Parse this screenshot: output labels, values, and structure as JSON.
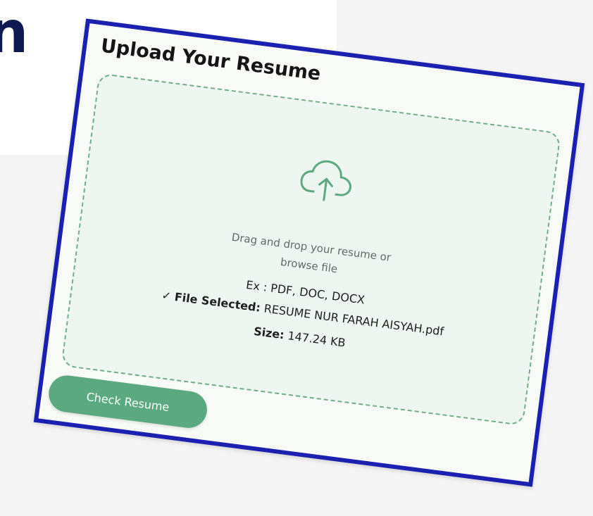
{
  "background": {
    "heading_fragment": "n"
  },
  "upload_card": {
    "title": "Upload Your Resume",
    "dropzone": {
      "icon": "cloud-upload-icon",
      "instruction_line1": "Drag and drop your resume or",
      "instruction_line2": "browse file",
      "formats": "Ex : PDF, DOC, DOCX",
      "file_selected_check": "✓",
      "file_selected_label": "File Selected:",
      "file_name": "RESUME NUR FARAH AISYAH.pdf",
      "size_label": "Size:",
      "size_value": "147.24 KB"
    },
    "check_button_label": "Check Resume"
  },
  "colors": {
    "card_border": "#1a21b0",
    "accent_green": "#5aa97f",
    "dropzone_border": "#6fae84",
    "heading_navy": "#0d1a52"
  }
}
